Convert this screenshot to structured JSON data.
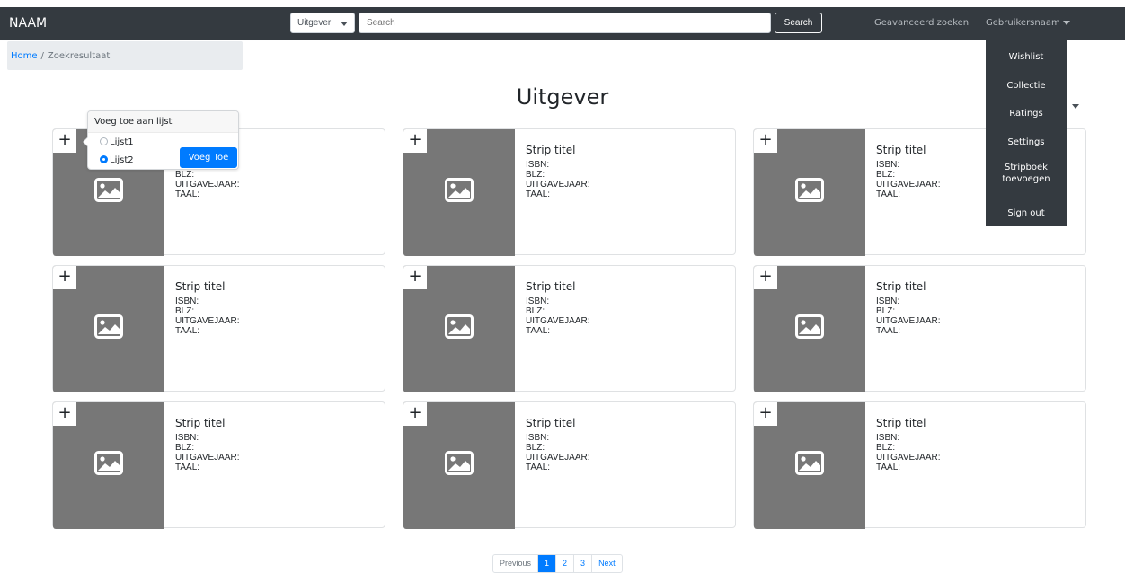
{
  "navbar": {
    "brand": "NAAM",
    "category_select": "Uitgever",
    "search_placeholder": "Search",
    "search_button": "Search",
    "advanced_search": "Geavanceerd zoeken",
    "username": "Gebruikersnaam"
  },
  "user_menu": {
    "items": [
      "Wishlist",
      "Collectie",
      "Ratings",
      "Settings",
      "Stripboek toevoegen",
      "Sign out"
    ]
  },
  "breadcrumb": {
    "home": "Home",
    "separator": "/",
    "current": "Zoekresultaat"
  },
  "page_title": "Uitgever",
  "add_to_list_popover": {
    "title": "Voeg toe aan lijst",
    "options": [
      {
        "label": "Lijst1",
        "selected": false
      },
      {
        "label": "Lijst2",
        "selected": true
      }
    ],
    "button": "Voeg Toe"
  },
  "cards": [
    {
      "title": "Strip titel",
      "isbn": "ISBN:",
      "blz": "BLZ:",
      "year": "UITGAVEJAAR:",
      "lang": "TAAL:"
    },
    {
      "title": "Strip titel",
      "isbn": "ISBN:",
      "blz": "BLZ:",
      "year": "UITGAVEJAAR:",
      "lang": "TAAL:"
    },
    {
      "title": "Strip titel",
      "isbn": "ISBN:",
      "blz": "BLZ:",
      "year": "UITGAVEJAAR:",
      "lang": "TAAL:"
    },
    {
      "title": "Strip titel",
      "isbn": "ISBN:",
      "blz": "BLZ:",
      "year": "UITGAVEJAAR:",
      "lang": "TAAL:"
    },
    {
      "title": "Strip titel",
      "isbn": "ISBN:",
      "blz": "BLZ:",
      "year": "UITGAVEJAAR:",
      "lang": "TAAL:"
    },
    {
      "title": "Strip titel",
      "isbn": "ISBN:",
      "blz": "BLZ:",
      "year": "UITGAVEJAAR:",
      "lang": "TAAL:"
    },
    {
      "title": "Strip titel",
      "isbn": "ISBN:",
      "blz": "BLZ:",
      "year": "UITGAVEJAAR:",
      "lang": "TAAL:"
    },
    {
      "title": "Strip titel",
      "isbn": "ISBN:",
      "blz": "BLZ:",
      "year": "UITGAVEJAAR:",
      "lang": "TAAL:"
    },
    {
      "title": "Strip titel",
      "isbn": "ISBN:",
      "blz": "BLZ:",
      "year": "UITGAVEJAAR:",
      "lang": "TAAL:"
    }
  ],
  "pagination": {
    "previous": "Previous",
    "pages": [
      "1",
      "2",
      "3"
    ],
    "active_page": "1",
    "next": "Next"
  },
  "colors": {
    "navbar_bg": "#343a40",
    "primary": "#007bff",
    "thumbnail": "#777777",
    "breadcrumb_bg": "#e9ecef"
  },
  "icons": {
    "card_image": "image-placeholder-icon",
    "card_add": "plus-icon",
    "dropdown": "caret-down-icon"
  }
}
